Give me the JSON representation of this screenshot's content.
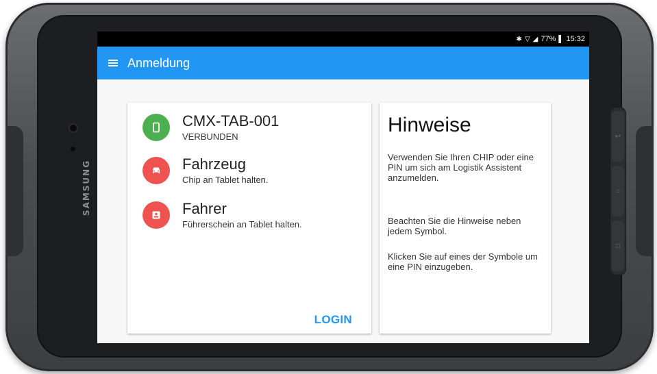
{
  "device": {
    "brand": "SAMSUNG"
  },
  "status_bar": {
    "bluetooth_icon": "bluetooth-icon",
    "wifi_icon": "wifi-icon",
    "signal_icon": "signal-icon",
    "battery_percent": "77%",
    "battery_icon": "battery-icon",
    "time": "15:32"
  },
  "appbar": {
    "menu_icon": "hamburger-menu-icon",
    "title": "Anmeldung",
    "color": "#2196f3"
  },
  "connection_card": {
    "items": [
      {
        "title": "CMX-TAB-001",
        "subtitle": "VERBUNDEN",
        "icon": "tablet-icon",
        "color": "#4caf50"
      },
      {
        "title": "Fahrzeug",
        "subtitle": "Chip an Tablet halten.",
        "icon": "car-icon",
        "color": "#ef5350"
      },
      {
        "title": "Fahrer",
        "subtitle": "Führerschein an Tablet halten.",
        "icon": "id-badge-icon",
        "color": "#ef5350"
      }
    ],
    "login_label": "LOGIN"
  },
  "hints_card": {
    "title": "Hinweise",
    "paragraphs": [
      "Verwenden Sie Ihren CHIP oder eine PIN um sich am Logistik Assistent anzumelden.",
      "Beachten Sie die Hinweise neben jedem Symbol.",
      "Klicken Sie auf eines der Symbole um eine PIN einzugeben."
    ]
  }
}
